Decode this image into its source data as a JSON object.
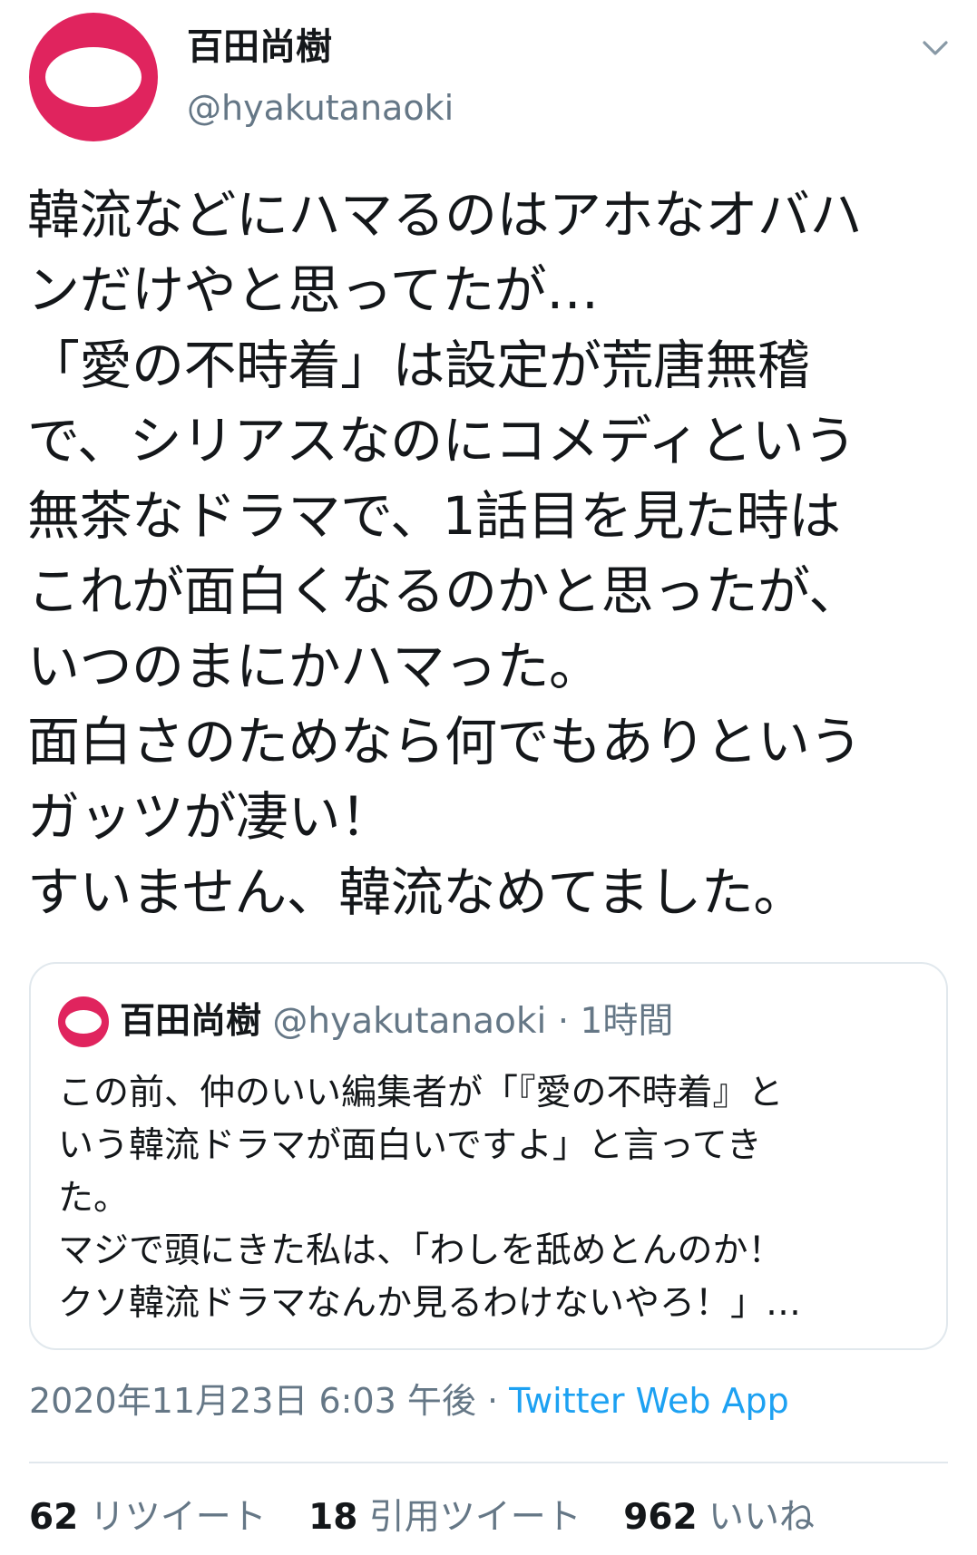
{
  "author": {
    "display_name": "百田尚樹",
    "handle": "@hyakutanaoki"
  },
  "colors": {
    "avatar_bg": "#e0245e",
    "link": "#1da1f2",
    "secondary_text": "#657786"
  },
  "icons": {
    "menu_caret": "chevron-down-icon"
  },
  "tweet": {
    "lines": [
      "韓流などにハマるのはアホなオバハ",
      "ンだけやと思ってたが…",
      "「愛の不時着」は設定が荒唐無稽",
      "で、シリアスなのにコメディという",
      "無茶なドラマで、1話目を見た時は",
      "これが面白くなるのかと思ったが、",
      "いつのまにかハマった。",
      "面白さのためなら何でもありという",
      "ガッツが凄い！",
      "すいません、韓流なめてました。"
    ]
  },
  "quote": {
    "display_name": "百田尚樹",
    "handle": "@hyakutanaoki",
    "separator": " · ",
    "time": "1時間",
    "lines": [
      "この前、仲のいい編集者が「『愛の不時着』と",
      "いう韓流ドラマが面白いですよ」と言ってき",
      "た。",
      "マジで頭にきた私は、「わしを舐めとんのか！",
      "クソ韓流ドラマなんか見るわけないやろ！」…"
    ]
  },
  "meta": {
    "timestamp": "2020年11月23日 6:03 午後",
    "separator": " · ",
    "source": "Twitter Web App"
  },
  "stats": {
    "retweets_count": "62",
    "retweets_label": "リツイート",
    "quotes_count": "18",
    "quotes_label": "引用ツイート",
    "likes_count": "962",
    "likes_label": "いいね"
  }
}
